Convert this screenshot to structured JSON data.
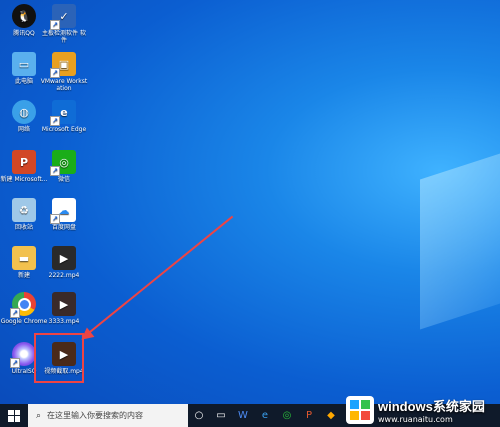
{
  "desktop_icons": [
    {
      "label": "腾讯QQ",
      "icon": "qq-icon"
    },
    {
      "label": "主板检测软件 软件",
      "icon": "shield-icon"
    },
    {
      "label": "此电脑",
      "icon": "computer-icon"
    },
    {
      "label": "VMware Workstation",
      "icon": "vmware-icon"
    },
    {
      "label": "网络",
      "icon": "network-icon"
    },
    {
      "label": "Microsoft Edge",
      "icon": "edge-icon"
    },
    {
      "label": "新建 Microsoft...",
      "icon": "powerpoint-icon"
    },
    {
      "label": "微信",
      "icon": "wechat-icon"
    },
    {
      "label": "回收站",
      "icon": "recycle-bin-icon"
    },
    {
      "label": "百度网盘",
      "icon": "baidu-netdisk-icon"
    },
    {
      "label": "新建",
      "icon": "folder-icon"
    },
    {
      "label": "2222.mp4",
      "icon": "video-file-icon"
    },
    {
      "label": "Google Chrome",
      "icon": "chrome-icon"
    },
    {
      "label": "3333.mp4",
      "icon": "video-file-icon"
    },
    {
      "label": "UltraISO",
      "icon": "ultraiso-icon"
    },
    {
      "label": "视频截取.mp4",
      "icon": "video-file-icon"
    }
  ],
  "taskbar": {
    "search_placeholder": "在这里输入你要搜索的内容",
    "items": [
      {
        "icon": "cortana-icon"
      },
      {
        "icon": "task-view-icon"
      },
      {
        "icon": "word-icon",
        "text": "W"
      },
      {
        "icon": "edge-taskbar-icon",
        "text": "e"
      },
      {
        "icon": "wechat-taskbar-icon",
        "text": "◎"
      },
      {
        "icon": "powerpoint-taskbar-icon",
        "text": "P"
      },
      {
        "icon": "app-taskbar-icon",
        "text": "◆"
      }
    ]
  },
  "watermark": {
    "main": "windows系统家园",
    "sub": "www.ruanaitu.com"
  }
}
